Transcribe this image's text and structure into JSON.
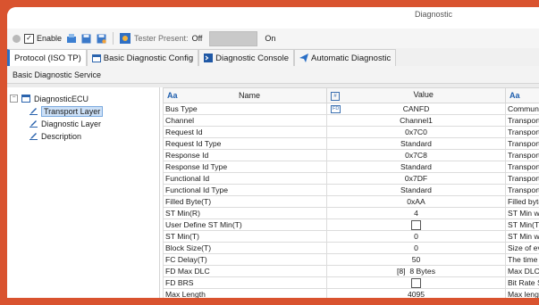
{
  "window": {
    "title": "Diagnostic"
  },
  "toolbar": {
    "enable_label": "Enable",
    "enable_checked": true,
    "tester_present_label": "Tester Present:",
    "off_label": "Off",
    "on_label": "On"
  },
  "tabs": [
    {
      "label": "Protocol (ISO TP)",
      "active": true
    },
    {
      "label": "Basic Diagnostic Config",
      "icon": "window-icon"
    },
    {
      "label": "Diagnostic Console",
      "icon": "console-icon"
    },
    {
      "label": "Automatic Diagnostic",
      "icon": "send-icon"
    }
  ],
  "section": {
    "title": "Basic Diagnostic Service"
  },
  "tree": {
    "root": "DiagnosticECU",
    "items": [
      "Transport Layer",
      "Diagnostic Layer",
      "Description"
    ],
    "selected": "Transport Layer"
  },
  "table": {
    "headers": {
      "name_icon": "Aa",
      "name": "Name",
      "value_icon": "#",
      "value": "Value",
      "comment_icon": "Aa"
    },
    "rows": [
      {
        "name": "Bus Type",
        "value": "CANFD",
        "comment": "Communi",
        "badge": "FD"
      },
      {
        "name": "Channel",
        "value": "Channel1",
        "comment": "Transport"
      },
      {
        "name": "Request Id",
        "value": "0x7C0",
        "comment": "Transport"
      },
      {
        "name": "Request Id Type",
        "value": "Standard",
        "comment": "Transport"
      },
      {
        "name": "Response Id",
        "value": "0x7C8",
        "comment": "Transport"
      },
      {
        "name": "Response Id Type",
        "value": "Standard",
        "comment": "Transport"
      },
      {
        "name": "Functional Id",
        "value": "0x7DF",
        "comment": "Transport"
      },
      {
        "name": "Functional Id Type",
        "value": "Standard",
        "comment": "Transport"
      },
      {
        "name": "Filled Byte(T)",
        "value": "0xAA",
        "comment": "Filled byte"
      },
      {
        "name": "ST Min(R)",
        "value": "4",
        "comment": "ST Min wh"
      },
      {
        "name": "User Define ST Min(T)",
        "value": "",
        "comment": "ST Min(T)",
        "checkbox": true
      },
      {
        "name": "ST Min(T)",
        "value": "0",
        "comment": "ST Min wh"
      },
      {
        "name": "Block Size(T)",
        "value": "0",
        "comment": "Size of eve"
      },
      {
        "name": "FC Delay(T)",
        "value": "50",
        "comment": "The time I"
      },
      {
        "name": "FD Max DLC",
        "value": "[8]  8 Bytes",
        "comment": "Max DLC"
      },
      {
        "name": "FD BRS",
        "value": "",
        "comment": "Bit Rate S",
        "checkbox": true
      },
      {
        "name": "Max Length",
        "value": "4095",
        "comment": "Max lengt"
      }
    ]
  },
  "colors": {
    "accent": "#2b6fc2",
    "frame": "#d9532f",
    "selection": "#cce0f7"
  }
}
